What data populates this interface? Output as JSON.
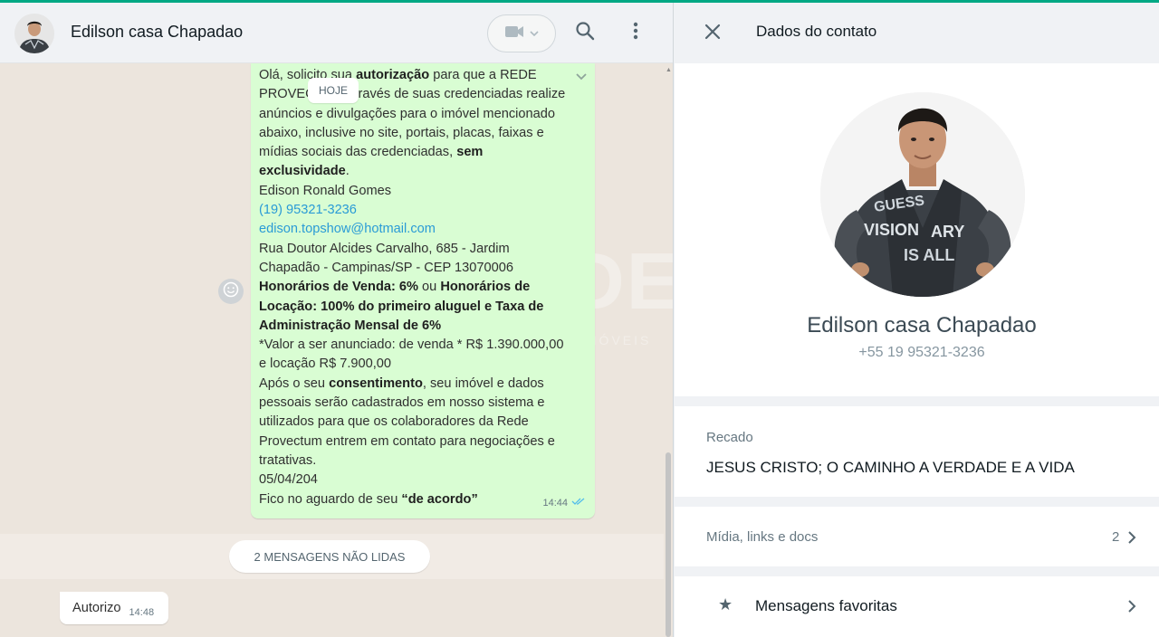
{
  "chat": {
    "contact_name": "Edilson casa Chapadao",
    "header_icons": {
      "video": "video-camera-icon",
      "search": "search-icon",
      "menu": "more-vertical-icon"
    },
    "day_chip": "HOJE",
    "outgoing_message": {
      "l1a": "Olá, solicito sua ",
      "l1b": "autorização",
      "l1c": " para que a REDE",
      "l2": "PROVECTUM através de suas credenciadas realize",
      "l3": "anúncios e divulgações para o imóvel mencionado",
      "l4": "abaixo, inclusive no site, portais, placas, faixas e",
      "l5a": "mídias sociais das credenciadas, ",
      "l5b": "sem",
      "l6a": "exclusividade",
      "l6b": ".",
      "l7": "Edison Ronald Gomes",
      "l8": "(19) 95321-3236",
      "l9": "edison.topshow@hotmail.com",
      "l10": "Rua Doutor Alcides Carvalho, 685 - Jardim",
      "l11": "Chapadão - Campinas/SP - CEP 13070006",
      "l12a": "Honorários de Venda: 6%",
      "l12b": " ou ",
      "l12c": "Honorários de",
      "l13": "Locação: 100% do primeiro aluguel e Taxa de",
      "l14": "Administração Mensal de 6%",
      "l15": "*Valor a ser anunciado: de venda * R$ 1.390.000,00",
      "l16": "e locação R$ 7.900,00",
      "l17a": "Após o seu ",
      "l17b": "consentimento",
      "l17c": ", seu imóvel e dados",
      "l18": "pessoais serão cadastrados em nosso sistema e",
      "l19": "utilizados para que os colaboradores da Rede",
      "l20": "Provectum entrem em contato para negociações e",
      "l21": "tratativas.",
      "l22": "05/04/204",
      "l23a": "Fico no aguardo de seu ",
      "l23b": "“de acordo”",
      "time": "14:44",
      "status_icon": "double-check-icon"
    },
    "unread_banner": "2 MENSAGENS NÃO LIDAS",
    "incoming_message": {
      "text": "Autorizo",
      "time": "14:48"
    },
    "watermark": "REDE",
    "watermark_sub": "IMÓVEIS"
  },
  "info": {
    "title": "Dados do contato",
    "name": "Edilson casa Chapadao",
    "phone": "+55 19 95321-3236",
    "about_label": "Recado",
    "about_text": "JESUS CRISTO; O CAMINHO A VERDADE E A VIDA",
    "media_label": "Mídia, links e docs",
    "media_count": "2",
    "favorites_label": "Mensagens favoritas"
  },
  "colors": {
    "accent": "#00a884",
    "outgoing_bubble": "#d9fdd3",
    "link": "#2a9bd6",
    "read_ticks": "#53bdeb"
  }
}
